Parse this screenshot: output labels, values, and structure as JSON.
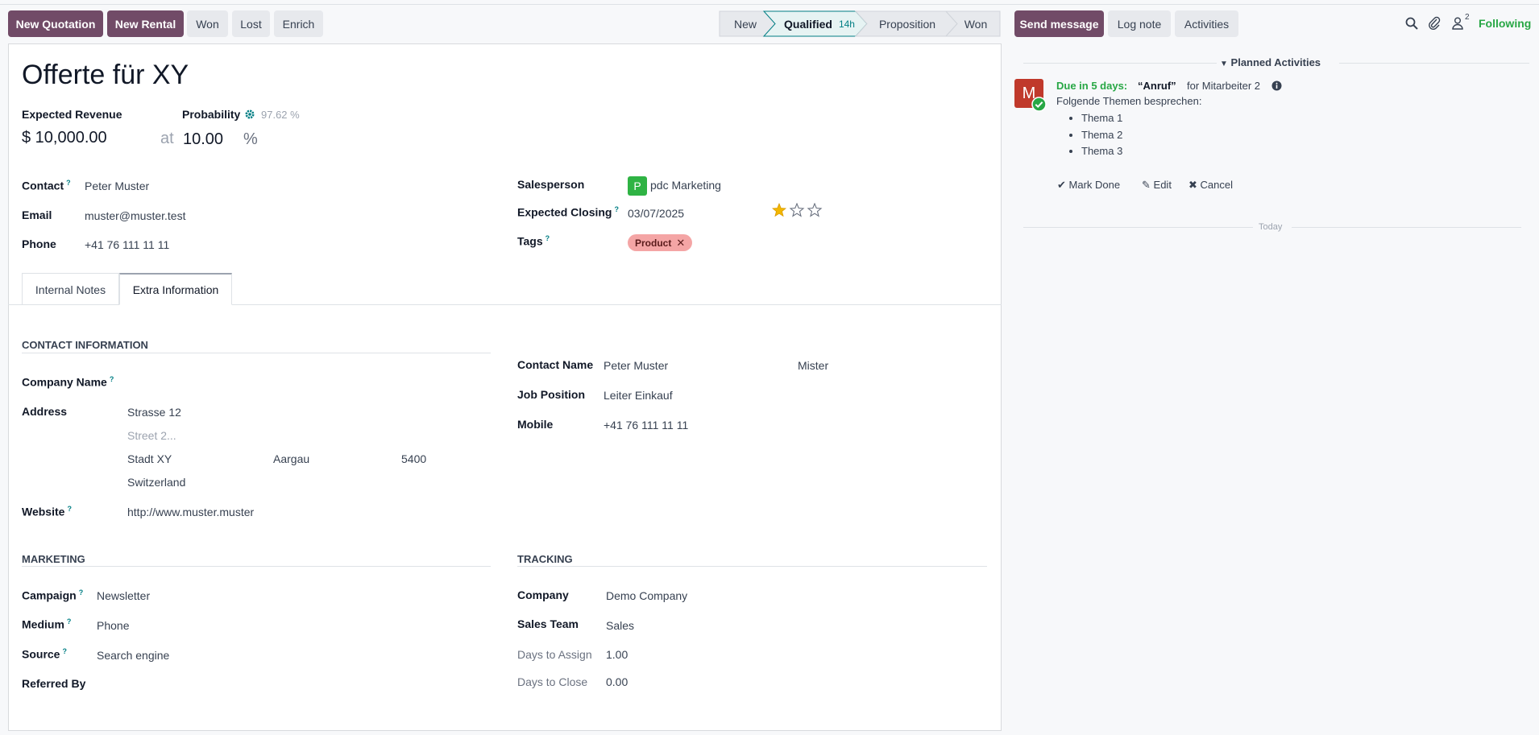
{
  "toolbar": {
    "new_quotation": "New Quotation",
    "new_rental": "New Rental",
    "won": "Won",
    "lost": "Lost",
    "enrich": "Enrich"
  },
  "stages": [
    {
      "label": "New"
    },
    {
      "label": "Qualified",
      "badge": "14h"
    },
    {
      "label": "Proposition"
    },
    {
      "label": "Won"
    }
  ],
  "record": {
    "title": "Offerte für XY",
    "expected_revenue_label": "Expected Revenue",
    "expected_revenue": "$ 10,000.00",
    "at_label": "at",
    "probability_label": "Probability",
    "probability_auto": "97.62 %",
    "probability_value": "10.00",
    "percent": "%",
    "contact_label": "Contact",
    "contact": "Peter Muster",
    "email_label": "Email",
    "email": "muster@muster.test",
    "phone_label": "Phone",
    "phone": "+41 76 111 11 11",
    "salesperson_label": "Salesperson",
    "salesperson_avatar": "P",
    "salesperson": "pdc Marketing",
    "expected_closing_label": "Expected Closing",
    "expected_closing": "03/07/2025",
    "priority_stars": 1,
    "tags_label": "Tags",
    "tag": "Product",
    "help_mark": "?"
  },
  "tabs": [
    {
      "label": "Internal Notes"
    },
    {
      "label": "Extra Information"
    }
  ],
  "contact_info": {
    "heading": "CONTACT INFORMATION",
    "company_name_label": "Company Name",
    "address_label": "Address",
    "street": "Strasse 12",
    "street2_placeholder": "Street 2...",
    "city": "Stadt XY",
    "state": "Aargau",
    "zip": "5400",
    "country": "Switzerland",
    "website_label": "Website",
    "website": "http://www.muster.muster",
    "contact_name_label": "Contact Name",
    "contact_name": "Peter Muster",
    "title": "Mister",
    "job_position_label": "Job Position",
    "job_position": "Leiter Einkauf",
    "mobile_label": "Mobile",
    "mobile": "+41 76 111 11 11"
  },
  "marketing": {
    "heading": "MARKETING",
    "campaign_label": "Campaign",
    "campaign": "Newsletter",
    "medium_label": "Medium",
    "medium": "Phone",
    "source_label": "Source",
    "source": "Search engine",
    "referred_label": "Referred By"
  },
  "tracking": {
    "heading": "TRACKING",
    "company_label": "Company",
    "company": "Demo Company",
    "sales_team_label": "Sales Team",
    "sales_team": "Sales",
    "days_assign_label": "Days to Assign",
    "days_assign": "1.00",
    "days_close_label": "Days to Close",
    "days_close": "0.00"
  },
  "chatter": {
    "send_message": "Send message",
    "log_note": "Log note",
    "activities": "Activities",
    "followers_count": "2",
    "following": "Following",
    "planned_heading": "Planned Activities",
    "avatar_letter": "M",
    "due": "Due in 5 days:",
    "activity_name": "“Anruf”",
    "for_user": "for Mitarbeiter 2",
    "note_intro": "Folgende Themen besprechen:",
    "items": [
      "Thema 1",
      "Thema 2",
      "Thema 3"
    ],
    "mark_done": "Mark Done",
    "edit": "Edit",
    "cancel": "Cancel",
    "today": "Today"
  },
  "colors": {
    "primary": "#714b67",
    "teal": "#017e84",
    "green": "#28a745"
  }
}
